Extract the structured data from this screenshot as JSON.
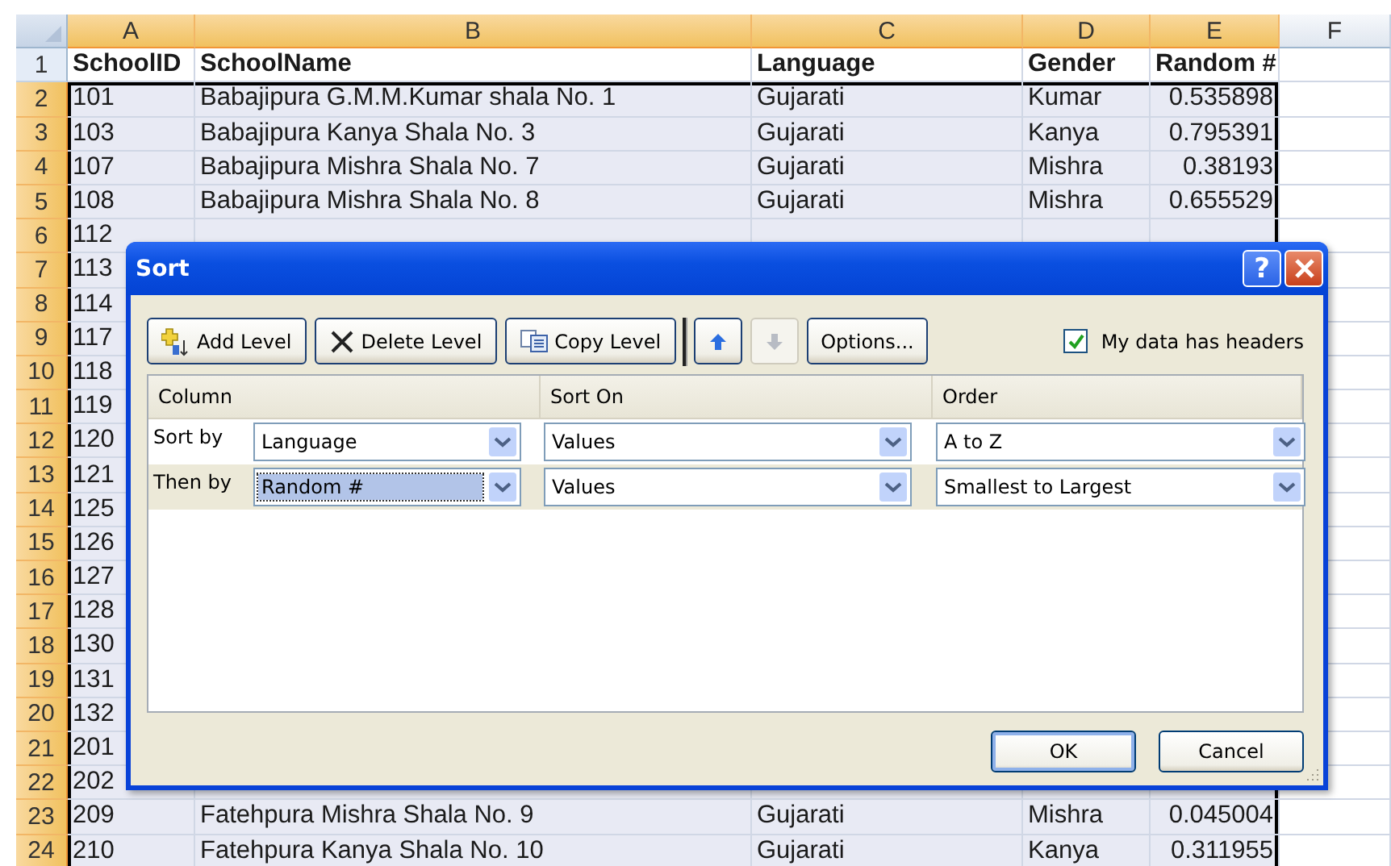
{
  "sheet": {
    "columns": [
      {
        "label": "A",
        "selected": true,
        "kind": "text"
      },
      {
        "label": "B",
        "selected": true,
        "kind": "text"
      },
      {
        "label": "C",
        "selected": true,
        "kind": "text"
      },
      {
        "label": "D",
        "selected": true,
        "kind": "text"
      },
      {
        "label": "E",
        "selected": true,
        "kind": "number"
      },
      {
        "label": "F",
        "selected": false,
        "kind": "text"
      }
    ],
    "rows": [
      {
        "number": "1",
        "kind": "header",
        "selected": false,
        "cells": [
          "SchoolID",
          "SchoolName",
          "Language",
          "Gender",
          "Random #"
        ]
      },
      {
        "number": "2",
        "kind": "data",
        "selected": true,
        "cells": [
          "101",
          "Babajipura G.M.M.Kumar shala No. 1",
          "Gujarati",
          "Kumar",
          "0.535898"
        ]
      },
      {
        "number": "3",
        "kind": "data",
        "selected": true,
        "cells": [
          "103",
          "Babajipura Kanya Shala No. 3",
          "Gujarati",
          "Kanya",
          "0.795391"
        ]
      },
      {
        "number": "4",
        "kind": "data",
        "selected": true,
        "cells": [
          "107",
          "Babajipura Mishra Shala No. 7",
          "Gujarati",
          "Mishra",
          "0.38193"
        ]
      },
      {
        "number": "5",
        "kind": "data",
        "selected": true,
        "cells": [
          "108",
          "Babajipura Mishra Shala No. 8",
          "Gujarati",
          "Mishra",
          "0.655529"
        ]
      },
      {
        "number": "6",
        "kind": "data",
        "selected": true,
        "cells": [
          "112"
        ]
      },
      {
        "number": "7",
        "kind": "data",
        "selected": true,
        "cells": [
          "113"
        ]
      },
      {
        "number": "8",
        "kind": "data",
        "selected": true,
        "cells": [
          "114"
        ]
      },
      {
        "number": "9",
        "kind": "data",
        "selected": true,
        "cells": [
          "117"
        ]
      },
      {
        "number": "10",
        "kind": "data",
        "selected": true,
        "cells": [
          "118"
        ]
      },
      {
        "number": "11",
        "kind": "data",
        "selected": true,
        "cells": [
          "119"
        ]
      },
      {
        "number": "12",
        "kind": "data",
        "selected": true,
        "cells": [
          "120"
        ]
      },
      {
        "number": "13",
        "kind": "data",
        "selected": true,
        "cells": [
          "121"
        ]
      },
      {
        "number": "14",
        "kind": "data",
        "selected": true,
        "cells": [
          "125"
        ]
      },
      {
        "number": "15",
        "kind": "data",
        "selected": true,
        "cells": [
          "126"
        ]
      },
      {
        "number": "16",
        "kind": "data",
        "selected": true,
        "cells": [
          "127"
        ]
      },
      {
        "number": "17",
        "kind": "data",
        "selected": true,
        "cells": [
          "128"
        ]
      },
      {
        "number": "18",
        "kind": "data",
        "selected": true,
        "cells": [
          "130"
        ]
      },
      {
        "number": "19",
        "kind": "data",
        "selected": true,
        "cells": [
          "131"
        ]
      },
      {
        "number": "20",
        "kind": "data",
        "selected": true,
        "cells": [
          "132"
        ]
      },
      {
        "number": "21",
        "kind": "data",
        "selected": true,
        "cells": [
          "201"
        ]
      },
      {
        "number": "22",
        "kind": "data",
        "selected": true,
        "cells": [
          "202"
        ]
      },
      {
        "number": "23",
        "kind": "data",
        "selected": true,
        "cells": [
          "209",
          "Fatehpura Mishra Shala No. 9",
          "Gujarati",
          "Mishra",
          "0.045004"
        ]
      },
      {
        "number": "24",
        "kind": "data",
        "selected": true,
        "cells": [
          "210",
          "Fatehpura Kanya Shala No. 10",
          "Gujarati",
          "Kanya",
          "0.311955"
        ]
      }
    ]
  },
  "dialog": {
    "title": "Sort",
    "help_button": "?",
    "toolbar": [
      {
        "kind": "add",
        "label": "Add Level",
        "disabled": false
      },
      {
        "kind": "delete",
        "label": "Delete Level",
        "disabled": false
      },
      {
        "kind": "copy",
        "label": "Copy Level",
        "disabled": false
      },
      {
        "kind": "up",
        "disabled": false
      },
      {
        "kind": "down",
        "disabled": true
      },
      {
        "kind": "options",
        "label": "Options...",
        "disabled": false
      }
    ],
    "headers_checkbox": {
      "label": "My data has headers",
      "checked": true
    },
    "list_headers": [
      "Column",
      "Sort On",
      "Order"
    ],
    "levels": [
      {
        "label": "Sort by",
        "column": "Language",
        "sort_on": "Values",
        "order": "A to Z",
        "selected": false
      },
      {
        "label": "Then by",
        "column": "Random #",
        "sort_on": "Values",
        "order": "Smallest to Largest",
        "selected": true
      }
    ],
    "buttons": [
      "OK",
      "Cancel"
    ]
  }
}
